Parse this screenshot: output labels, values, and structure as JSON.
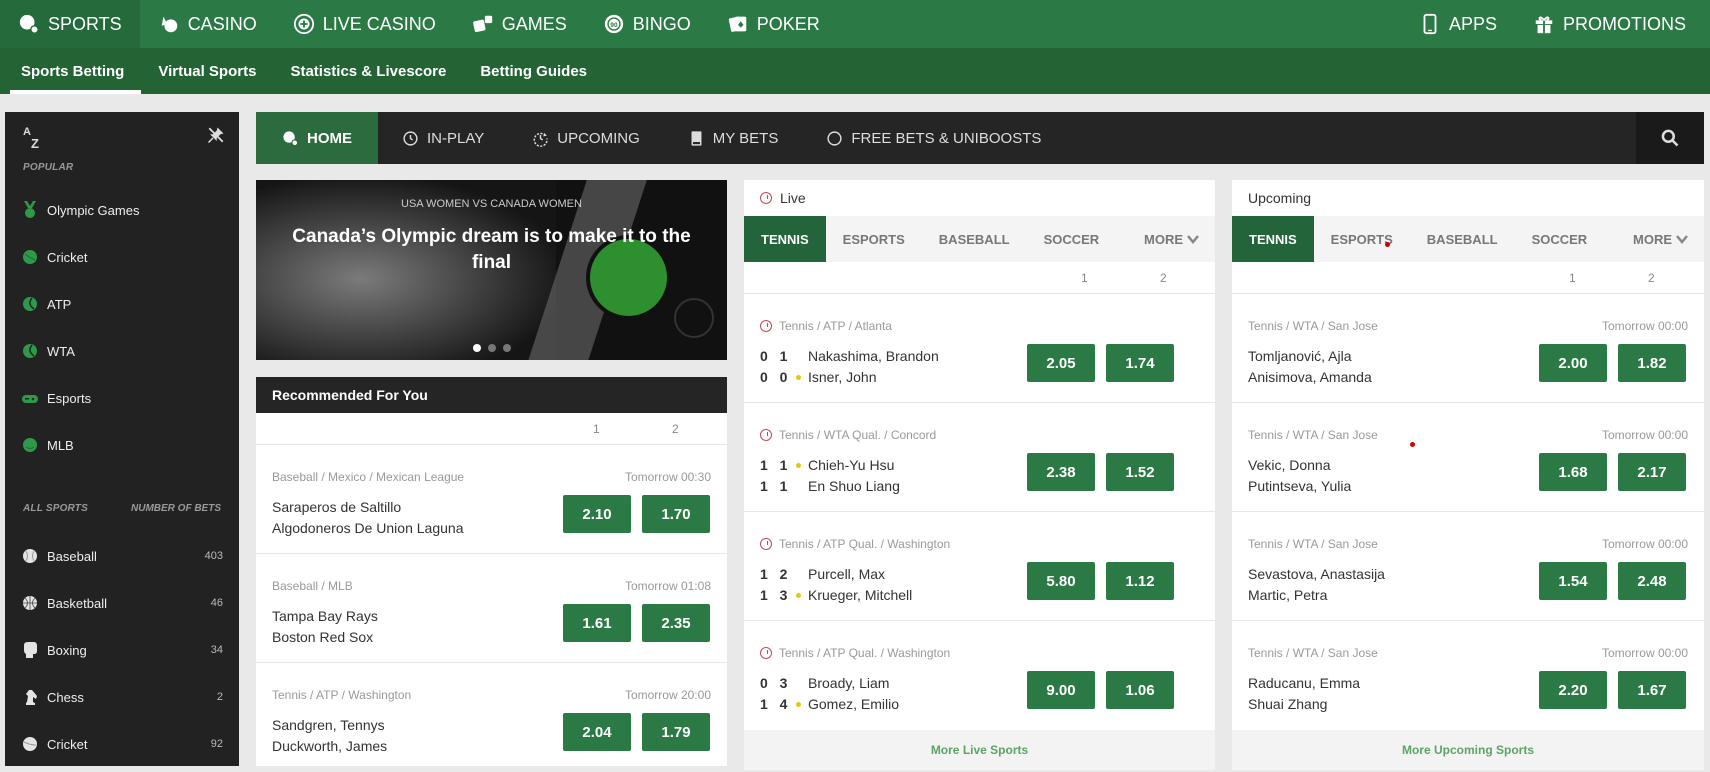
{
  "top_nav": {
    "items": [
      {
        "label": "SPORTS",
        "icon": "sports-icon",
        "active": true
      },
      {
        "label": "CASINO",
        "icon": "casino-icon"
      },
      {
        "label": "LIVE CASINO",
        "icon": "live-casino-icon"
      },
      {
        "label": "GAMES",
        "icon": "dice-icon"
      },
      {
        "label": "BINGO",
        "icon": "bingo-icon"
      },
      {
        "label": "POKER",
        "icon": "cards-icon"
      }
    ],
    "right_items": [
      {
        "label": "APPS",
        "icon": "phone-icon"
      },
      {
        "label": "PROMOTIONS",
        "icon": "gift-icon"
      }
    ]
  },
  "sub_nav": {
    "items": [
      "Sports Betting",
      "Virtual Sports",
      "Statistics & Livescore",
      "Betting Guides"
    ],
    "active": "Sports Betting"
  },
  "sidebar": {
    "az_label_top": "A",
    "az_label_bottom": "Z",
    "popular_heading": "POPULAR",
    "popular": [
      {
        "label": "Olympic Games",
        "icon": "medal-icon"
      },
      {
        "label": "Cricket",
        "icon": "cricket-ball-icon"
      },
      {
        "label": "ATP",
        "icon": "tennis-ball-icon"
      },
      {
        "label": "WTA",
        "icon": "tennis-ball-icon"
      },
      {
        "label": "Esports",
        "icon": "gamepad-icon"
      },
      {
        "label": "MLB",
        "icon": "baseball-icon"
      }
    ],
    "all_sports_heading": "ALL SPORTS",
    "number_of_bets_heading": "NUMBER OF BETS",
    "all_sports": [
      {
        "label": "Baseball",
        "count": "403",
        "icon": "baseball-icon"
      },
      {
        "label": "Basketball",
        "count": "46",
        "icon": "basketball-icon"
      },
      {
        "label": "Boxing",
        "count": "34",
        "icon": "boxing-glove-icon"
      },
      {
        "label": "Chess",
        "count": "2",
        "icon": "chess-knight-icon"
      },
      {
        "label": "Cricket",
        "count": "92",
        "icon": "cricket-ball-icon"
      }
    ]
  },
  "main_nav": {
    "items": [
      {
        "label": "HOME",
        "icon": "home-icon",
        "active": true
      },
      {
        "label": "IN-PLAY",
        "icon": "clock-icon"
      },
      {
        "label": "UPCOMING",
        "icon": "upcoming-icon"
      },
      {
        "label": "MY BETS",
        "icon": "betslip-icon"
      },
      {
        "label": "FREE BETS & UNIBOOSTS",
        "icon": "circle-icon"
      }
    ]
  },
  "banner": {
    "kicker": "USA WOMEN VS CANADA WOMEN",
    "title": "Canada’s Olympic dream is to make it to the final",
    "slides": 3,
    "active_slide": 1
  },
  "recommended": {
    "title": "Recommended For You",
    "col1": "1",
    "col2": "2",
    "events": [
      {
        "meta": "Baseball / Mexico / Mexican League",
        "time": "Tomorrow 00:30",
        "home": "Saraperos de Saltillo",
        "away": "Algodoneros De Union Laguna",
        "odd1": "2.10",
        "odd2": "1.70"
      },
      {
        "meta": "Baseball / MLB",
        "time": "Tomorrow 01:08",
        "home": "Tampa Bay Rays",
        "away": "Boston Red Sox",
        "odd1": "1.61",
        "odd2": "2.35"
      },
      {
        "meta": "Tennis / ATP / Washington",
        "time": "Tomorrow 20:00",
        "home": "Sandgren, Tennys",
        "away": "Duckworth, James",
        "odd1": "2.04",
        "odd2": "1.79"
      }
    ]
  },
  "live": {
    "title": "Live",
    "tabs": [
      "TENNIS",
      "ESPORTS",
      "BASEBALL",
      "SOCCER"
    ],
    "more_label": "MORE",
    "col1": "1",
    "col2": "2",
    "events": [
      {
        "meta": "Tennis / ATP / Atlanta",
        "home": "Nakashima, Brandon",
        "away": "Isner, John",
        "home_score": "0 1",
        "away_score": "0 0",
        "serving": "away",
        "odd1": "2.05",
        "odd2": "1.74"
      },
      {
        "meta": "Tennis / WTA Qual. / Concord",
        "home": "Chieh-Yu Hsu",
        "away": "En Shuo Liang",
        "home_score": "1 1",
        "away_score": "1 1",
        "serving": "home",
        "odd1": "2.38",
        "odd2": "1.52"
      },
      {
        "meta": "Tennis / ATP Qual. / Washington",
        "home": "Purcell, Max",
        "away": "Krueger, Mitchell",
        "home_score": "1 2",
        "away_score": "1 3",
        "serving": "away",
        "odd1": "5.80",
        "odd2": "1.12"
      },
      {
        "meta": "Tennis / ATP Qual. / Washington",
        "home": "Broady, Liam",
        "away": "Gomez, Emilio",
        "home_score": "0 3",
        "away_score": "1 4",
        "serving": "away",
        "odd1": "9.00",
        "odd2": "1.06"
      }
    ],
    "more_link": "More Live Sports"
  },
  "upcoming": {
    "title": "Upcoming",
    "tabs": [
      "TENNIS",
      "ESPORTS",
      "BASEBALL",
      "SOCCER"
    ],
    "more_label": "MORE",
    "col1": "1",
    "col2": "2",
    "events": [
      {
        "meta": "Tennis / WTA / San Jose",
        "time": "Tomorrow 00:00",
        "home": "Tomljanović, Ajla",
        "away": "Anisimova, Amanda",
        "odd1": "2.00",
        "odd2": "1.82"
      },
      {
        "meta": "Tennis / WTA / San Jose",
        "time": "Tomorrow 00:00",
        "home": "Vekic, Donna",
        "away": "Putintseva, Yulia",
        "odd1": "1.68",
        "odd2": "2.17"
      },
      {
        "meta": "Tennis / WTA / San Jose",
        "time": "Tomorrow 00:00",
        "home": "Sevastova, Anastasija",
        "away": "Martic, Petra",
        "odd1": "1.54",
        "odd2": "2.48"
      },
      {
        "meta": "Tennis / WTA / San Jose",
        "time": "Tomorrow 00:00",
        "home": "Raducanu, Emma",
        "away": "Shuai Zhang",
        "odd1": "2.20",
        "odd2": "1.67"
      }
    ],
    "more_link": "More Upcoming Sports"
  },
  "colors": {
    "brand_green": "#2b7a45",
    "dark_green": "#236334",
    "panel_dark": "#252525",
    "live_red": "#c0485a",
    "serve_yellow": "#e5c910"
  }
}
